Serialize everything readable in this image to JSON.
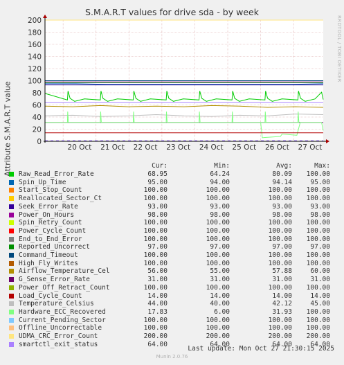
{
  "title": "S.M.A.R.T values for drive sda - by week",
  "side_credit": "RRDTOOL / TOBI OETIKER",
  "footer": "Munin 2.0.76",
  "last_update": "Last update: Mon Oct 27 21:30:15 2025",
  "legend_headers": {
    "cur": "Cur:",
    "min": "Min:",
    "avg": "Avg:",
    "max": "Max:"
  },
  "legend": [
    {
      "name": "Raw_Read_Error_Rate",
      "color": "#00CC00",
      "cur": "68.95",
      "min": "64.24",
      "avg": "80.09",
      "max": "100.00"
    },
    {
      "name": "Spin_Up_Time",
      "color": "#0066B3",
      "cur": "95.00",
      "min": "94.00",
      "avg": "94.14",
      "max": "95.00"
    },
    {
      "name": "Start_Stop_Count",
      "color": "#FF8000",
      "cur": "100.00",
      "min": "100.00",
      "avg": "100.00",
      "max": "100.00"
    },
    {
      "name": "Reallocated_Sector_Ct",
      "color": "#FFCC00",
      "cur": "100.00",
      "min": "100.00",
      "avg": "100.00",
      "max": "100.00"
    },
    {
      "name": "Seek_Error_Rate",
      "color": "#330099",
      "cur": "93.00",
      "min": "93.00",
      "avg": "93.00",
      "max": "93.00"
    },
    {
      "name": "Power_On_Hours",
      "color": "#990099",
      "cur": "98.00",
      "min": "98.00",
      "avg": "98.00",
      "max": "98.00"
    },
    {
      "name": "Spin_Retry_Count",
      "color": "#CCFF00",
      "cur": "100.00",
      "min": "100.00",
      "avg": "100.00",
      "max": "100.00"
    },
    {
      "name": "Power_Cycle_Count",
      "color": "#FF0000",
      "cur": "100.00",
      "min": "100.00",
      "avg": "100.00",
      "max": "100.00"
    },
    {
      "name": "End_to_End_Error",
      "color": "#808080",
      "cur": "100.00",
      "min": "100.00",
      "avg": "100.00",
      "max": "100.00"
    },
    {
      "name": "Reported_Uncorrect",
      "color": "#008F00",
      "cur": "97.00",
      "min": "97.00",
      "avg": "97.00",
      "max": "97.00"
    },
    {
      "name": "Command_Timeout",
      "color": "#00487D",
      "cur": "100.00",
      "min": "100.00",
      "avg": "100.00",
      "max": "100.00"
    },
    {
      "name": "High_Fly_Writes",
      "color": "#B35A00",
      "cur": "100.00",
      "min": "100.00",
      "avg": "100.00",
      "max": "100.00"
    },
    {
      "name": "Airflow_Temperature_Cel",
      "color": "#B38F00",
      "cur": "56.00",
      "min": "55.00",
      "avg": "57.88",
      "max": "60.00"
    },
    {
      "name": "G_Sense_Error_Rate",
      "color": "#6B006B",
      "cur": "31.00",
      "min": "31.00",
      "avg": "31.00",
      "max": "31.00"
    },
    {
      "name": "Power_Off_Retract_Count",
      "color": "#8FB300",
      "cur": "100.00",
      "min": "100.00",
      "avg": "100.00",
      "max": "100.00"
    },
    {
      "name": "Load_Cycle_Count",
      "color": "#B30000",
      "cur": "14.00",
      "min": "14.00",
      "avg": "14.00",
      "max": "14.00"
    },
    {
      "name": "Temperature_Celsius",
      "color": "#BEBEBE",
      "cur": "44.00",
      "min": "40.00",
      "avg": "42.12",
      "max": "45.00"
    },
    {
      "name": "Hardware_ECC_Recovered",
      "color": "#80FF80",
      "cur": "17.83",
      "min": "6.00",
      "avg": "31.93",
      "max": "100.00"
    },
    {
      "name": "Current_Pending_Sector",
      "color": "#80C9FF",
      "cur": "100.00",
      "min": "100.00",
      "avg": "100.00",
      "max": "100.00"
    },
    {
      "name": "Offline_Uncorrectable",
      "color": "#FFC080",
      "cur": "100.00",
      "min": "100.00",
      "avg": "100.00",
      "max": "100.00"
    },
    {
      "name": "UDMA_CRC_Error_Count",
      "color": "#FFE680",
      "cur": "200.00",
      "min": "200.00",
      "avg": "200.00",
      "max": "200.00"
    },
    {
      "name": "smartctl_exit_status",
      "color": "#AA80FF",
      "cur": "64.00",
      "min": "64.00",
      "avg": "64.00",
      "max": "64.00"
    }
  ],
  "chart_data": {
    "type": "line",
    "title": "S.M.A.R.T values for drive sda - by week",
    "ylabel": "Attribute S.M.A.R.T value",
    "ylim": [
      0,
      200
    ],
    "yticks": [
      0,
      20,
      40,
      60,
      80,
      100,
      120,
      140,
      160,
      180,
      200
    ],
    "xticks": [
      "20 Oct",
      "21 Oct",
      "22 Oct",
      "23 Oct",
      "24 Oct",
      "25 Oct",
      "26 Oct",
      "27 Oct"
    ],
    "xrange_days": [
      19.45,
      27.9
    ],
    "grid": true,
    "series": [
      {
        "name": "Raw_Read_Error_Rate",
        "color": "#00CC00",
        "style": "sawtooth",
        "low": 64.24,
        "high": 83,
        "cur": 68.95
      },
      {
        "name": "Spin_Up_Time",
        "color": "#0066B3",
        "values": [
          95,
          95,
          94,
          94,
          94,
          94,
          94,
          94,
          94,
          95
        ]
      },
      {
        "name": "Start_Stop_Count",
        "color": "#FF8000",
        "values": [
          100,
          100
        ]
      },
      {
        "name": "Reallocated_Sector_Ct",
        "color": "#FFCC00",
        "values": [
          100,
          100
        ]
      },
      {
        "name": "Seek_Error_Rate",
        "color": "#330099",
        "values": [
          93,
          93
        ]
      },
      {
        "name": "Power_On_Hours",
        "color": "#990099",
        "values": [
          98,
          98
        ]
      },
      {
        "name": "Spin_Retry_Count",
        "color": "#CCFF00",
        "values": [
          100,
          100
        ]
      },
      {
        "name": "Power_Cycle_Count",
        "color": "#FF0000",
        "values": [
          100,
          100
        ]
      },
      {
        "name": "End_to_End_Error",
        "color": "#808080",
        "values": [
          100,
          100
        ]
      },
      {
        "name": "Reported_Uncorrect",
        "color": "#008F00",
        "values": [
          97,
          97
        ]
      },
      {
        "name": "Command_Timeout",
        "color": "#00487D",
        "values": [
          100,
          100
        ]
      },
      {
        "name": "High_Fly_Writes",
        "color": "#B35A00",
        "values": [
          100,
          100
        ]
      },
      {
        "name": "Airflow_Temperature_Cel",
        "color": "#B38F00",
        "values": [
          58,
          57,
          59,
          57,
          58,
          57,
          59,
          58,
          56,
          57,
          56
        ]
      },
      {
        "name": "G_Sense_Error_Rate",
        "color": "#6B006B",
        "values": [
          31,
          31
        ]
      },
      {
        "name": "Power_Off_Retract_Count",
        "color": "#8FB300",
        "values": [
          100,
          100
        ]
      },
      {
        "name": "Load_Cycle_Count",
        "color": "#B30000",
        "values": [
          14,
          14
        ]
      },
      {
        "name": "Temperature_Celsius",
        "color": "#BEBEBE",
        "values": [
          42,
          43,
          41,
          42,
          44,
          42,
          41,
          43,
          42,
          45,
          44
        ]
      },
      {
        "name": "Hardware_ECC_Recovered",
        "color": "#80FF80",
        "style": "dips",
        "base": 31,
        "dip": 6,
        "cur": 17.83
      },
      {
        "name": "Current_Pending_Sector",
        "color": "#80C9FF",
        "values": [
          100,
          100
        ]
      },
      {
        "name": "Offline_Uncorrectable",
        "color": "#FFC080",
        "values": [
          100,
          100
        ]
      },
      {
        "name": "UDMA_CRC_Error_Count",
        "color": "#FFE680",
        "values": [
          200,
          200
        ]
      },
      {
        "name": "smartctl_exit_status",
        "color": "#AA80FF",
        "values": [
          64,
          64
        ]
      }
    ]
  }
}
